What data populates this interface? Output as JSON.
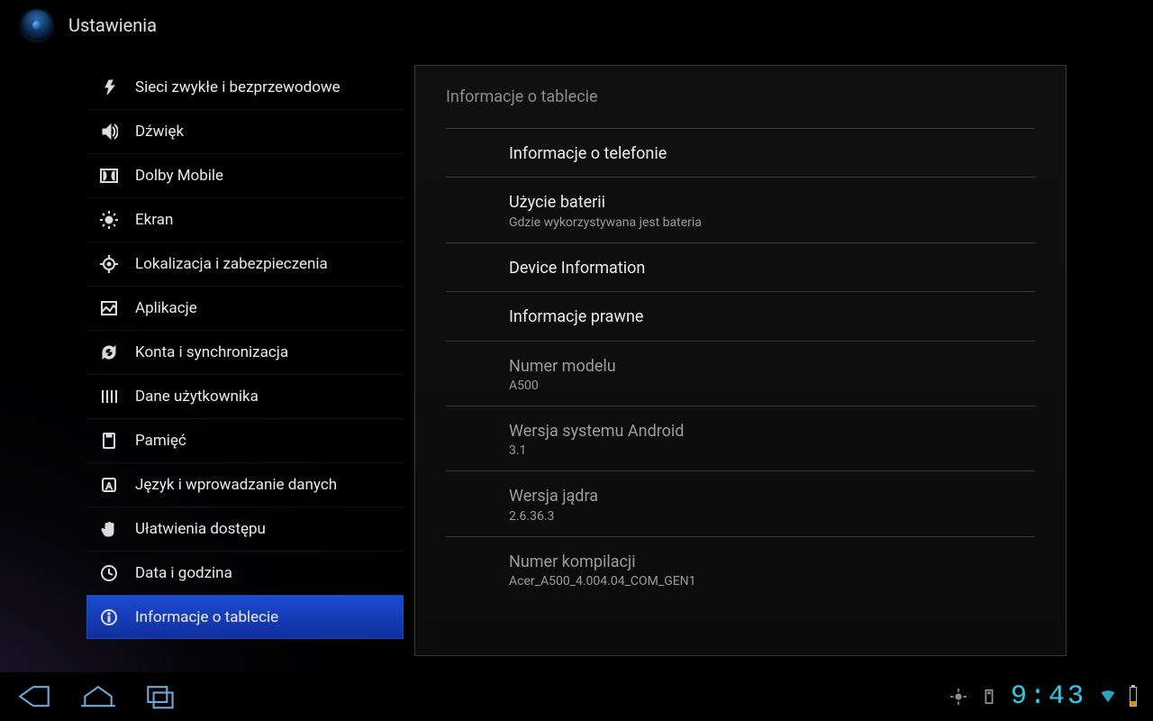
{
  "app": {
    "title": "Ustawienia"
  },
  "sidebar": {
    "items": [
      {
        "label": "Sieci zwykłe i bezprzewodowe",
        "icon": "wireless",
        "selected": false
      },
      {
        "label": "Dźwięk",
        "icon": "speaker",
        "selected": false
      },
      {
        "label": "Dolby Mobile",
        "icon": "dolby",
        "selected": false
      },
      {
        "label": "Ekran",
        "icon": "brightness",
        "selected": false
      },
      {
        "label": "Lokalizacja i zabezpieczenia",
        "icon": "location",
        "selected": false
      },
      {
        "label": "Aplikacje",
        "icon": "apps",
        "selected": false
      },
      {
        "label": "Konta i synchronizacja",
        "icon": "sync",
        "selected": false
      },
      {
        "label": "Dane użytkownika",
        "icon": "privacy",
        "selected": false
      },
      {
        "label": "Pamięć",
        "icon": "storage",
        "selected": false
      },
      {
        "label": "Język i wprowadzanie danych",
        "icon": "language",
        "selected": false
      },
      {
        "label": "Ułatwienia dostępu",
        "icon": "hand",
        "selected": false
      },
      {
        "label": "Data i godzina",
        "icon": "clock",
        "selected": false
      },
      {
        "label": "Informacje o tablecie",
        "icon": "info",
        "selected": true
      }
    ]
  },
  "panel": {
    "header": "Informacje o tablecie",
    "rows": [
      {
        "type": "link",
        "title": "Informacje o telefonie"
      },
      {
        "type": "link",
        "title": "Użycie baterii",
        "sub": "Gdzie wykorzystywana jest bateria"
      },
      {
        "type": "link",
        "title": "Device Information"
      },
      {
        "type": "link",
        "title": "Informacje prawne"
      },
      {
        "type": "info",
        "title": "Numer modelu",
        "sub": "A500"
      },
      {
        "type": "info",
        "title": "Wersja systemu Android",
        "sub": "3.1"
      },
      {
        "type": "info",
        "title": "Wersja jądra",
        "sub": "2.6.36.3"
      },
      {
        "type": "info",
        "title": "Numer kompilacji",
        "sub": "Acer_A500_4.004.04_COM_GEN1"
      }
    ]
  },
  "status": {
    "clock": "9:43",
    "batteryPercent": 25
  },
  "colors": {
    "selection": "#1b46c8",
    "clock": "#36c7e0"
  }
}
